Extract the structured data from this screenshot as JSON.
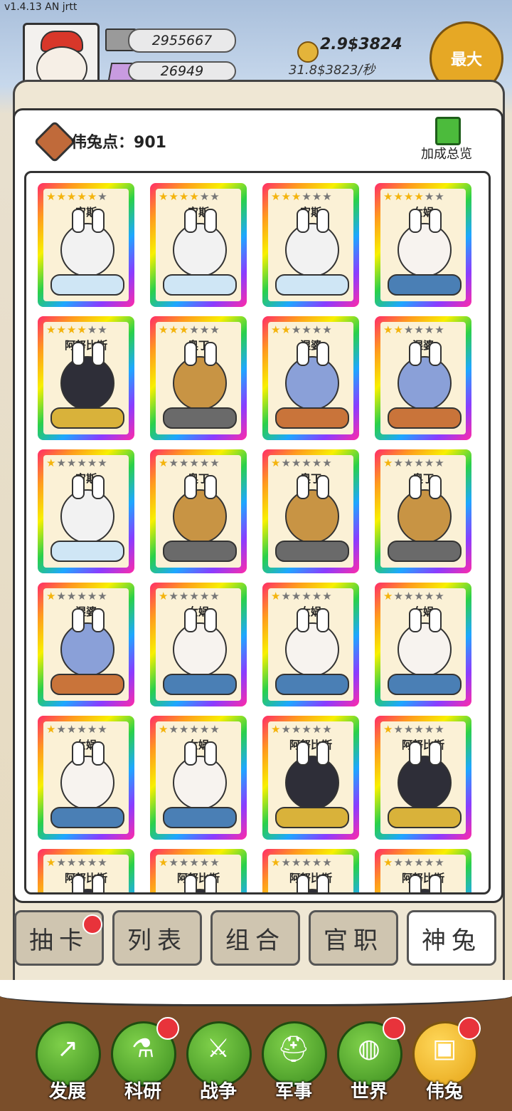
{
  "version": "v1.4.13 AN jrtt",
  "resources": {
    "silver": "2955667",
    "gems": "26949"
  },
  "gold": {
    "amount": "2.9$3824",
    "rate": "31.8$3823/秒"
  },
  "max_button": "最大",
  "points": {
    "label": "伟兔点：",
    "value": "901"
  },
  "bonus_overview": "加成总览",
  "colors": {
    "gold_accent": "#e6a825",
    "green_nav": "#4aa82a",
    "badge_red": "#e8333b"
  },
  "cards": [
    {
      "name": "宙斯",
      "stars": 5
    },
    {
      "name": "宙斯",
      "stars": 4
    },
    {
      "name": "宙斯",
      "stars": 3
    },
    {
      "name": "女娲",
      "stars": 4
    },
    {
      "name": "阿努比斯",
      "stars": 4
    },
    {
      "name": "奥丁",
      "stars": 3
    },
    {
      "name": "湿婆",
      "stars": 2
    },
    {
      "name": "湿婆",
      "stars": 2
    },
    {
      "name": "宙斯",
      "stars": 1
    },
    {
      "name": "奥丁",
      "stars": 1
    },
    {
      "name": "奥丁",
      "stars": 1
    },
    {
      "name": "奥丁",
      "stars": 1
    },
    {
      "name": "湿婆",
      "stars": 1
    },
    {
      "name": "女娲",
      "stars": 1
    },
    {
      "name": "女娲",
      "stars": 1
    },
    {
      "name": "女娲",
      "stars": 1
    },
    {
      "name": "女娲",
      "stars": 1
    },
    {
      "name": "女娲",
      "stars": 1
    },
    {
      "name": "阿努比斯",
      "stars": 1
    },
    {
      "name": "阿努比斯",
      "stars": 1
    },
    {
      "name": "阿努比斯",
      "stars": 1
    },
    {
      "name": "阿努比斯",
      "stars": 1
    },
    {
      "name": "阿努比斯",
      "stars": 1
    },
    {
      "name": "阿努比斯",
      "stars": 1
    }
  ],
  "tabs": [
    {
      "label": "抽卡",
      "badge": true
    },
    {
      "label": "列表",
      "badge": false
    },
    {
      "label": "组合",
      "badge": false
    },
    {
      "label": "官职",
      "badge": false
    },
    {
      "label": "神兔",
      "badge": false,
      "active": true
    }
  ],
  "nav": [
    {
      "label": "发展",
      "icon": "arrow-up-icon",
      "badge": false
    },
    {
      "label": "科研",
      "icon": "flask-icon",
      "badge": true
    },
    {
      "label": "战争",
      "icon": "swords-icon",
      "badge": false
    },
    {
      "label": "军事",
      "icon": "helmet-icon",
      "badge": false
    },
    {
      "label": "世界",
      "icon": "globe-icon",
      "badge": true
    },
    {
      "label": "伟兔",
      "icon": "bunny-portrait-icon",
      "badge": true,
      "active": true
    }
  ]
}
